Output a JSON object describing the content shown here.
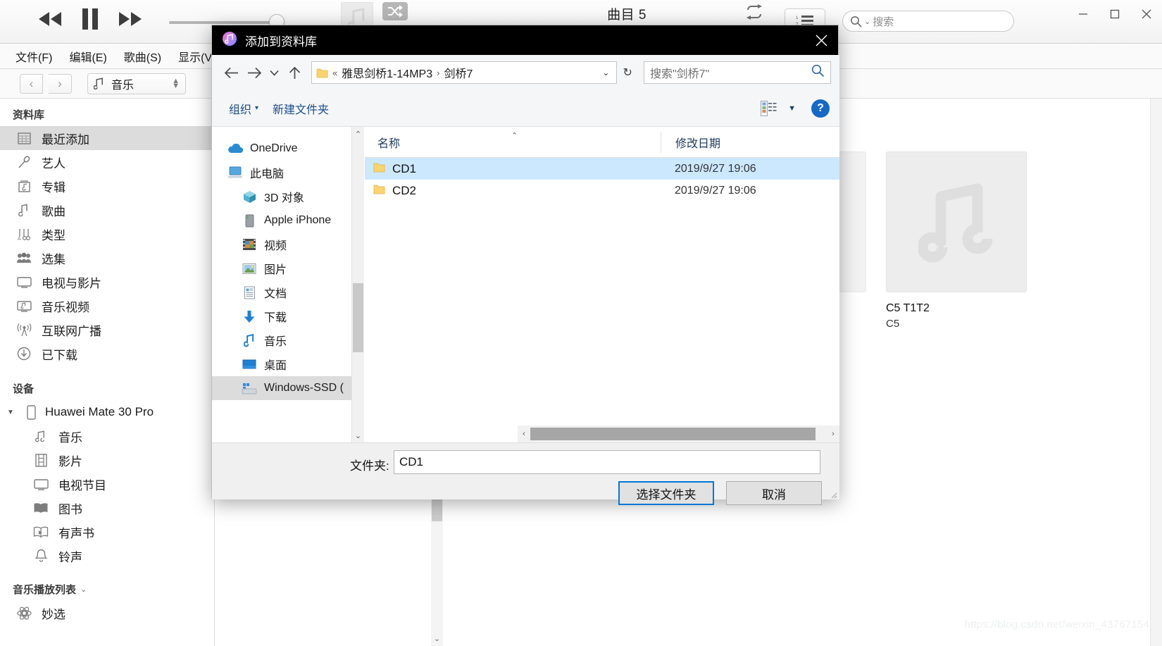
{
  "itunes": {
    "transport": {
      "previous": "rewind-icon",
      "play_pause": "pause-icon",
      "next": "fast-forward-icon"
    },
    "volume": {
      "level_percent": 89
    },
    "shuffle_label": "shuffle-icon",
    "repeat_label": "repeat-icon",
    "now_playing": "曲目 5",
    "search": {
      "placeholder": "搜索"
    },
    "window_controls": {
      "minimize": "—",
      "maximize": "▫",
      "close": "✕"
    },
    "menus": [
      "文件(F)",
      "编辑(E)",
      "歌曲(S)",
      "显示(V)"
    ],
    "library_picker": {
      "label": "音乐"
    },
    "sidebar": {
      "library_header": "资料库",
      "library_items": [
        {
          "label": "最近添加",
          "icon": "grid-icon",
          "selected": true
        },
        {
          "label": "艺人",
          "icon": "microphone-icon",
          "selected": false
        },
        {
          "label": "专辑",
          "icon": "album-icon",
          "selected": false
        },
        {
          "label": "歌曲",
          "icon": "note-icon",
          "selected": false
        },
        {
          "label": "类型",
          "icon": "genre-icon",
          "selected": false
        },
        {
          "label": "选集",
          "icon": "people-icon",
          "selected": false
        },
        {
          "label": "电视与影片",
          "icon": "tv-icon",
          "selected": false
        },
        {
          "label": "音乐视频",
          "icon": "music-video-icon",
          "selected": false
        },
        {
          "label": "互联网广播",
          "icon": "radio-icon",
          "selected": false
        },
        {
          "label": "已下载",
          "icon": "download-icon",
          "selected": false
        }
      ],
      "devices_header": "设备",
      "device_name": "Huawei Mate 30 Pro",
      "device_items": [
        {
          "label": "音乐",
          "icon": "note-icon"
        },
        {
          "label": "影片",
          "icon": "film-icon"
        },
        {
          "label": "电视节目",
          "icon": "tv-icon"
        },
        {
          "label": "图书",
          "icon": "book-icon"
        },
        {
          "label": "有声书",
          "icon": "audiobook-icon"
        },
        {
          "label": "铃声",
          "icon": "bell-icon"
        }
      ],
      "playlists_header": "音乐播放列表",
      "playlist_items": [
        {
          "label": "妙选",
          "icon": "genius-icon"
        }
      ]
    },
    "album": {
      "title": "C5 T1T2",
      "artist": "C5"
    },
    "watermark": "https://blog.csdn.net/weixin_43767154"
  },
  "dialog": {
    "title": "添加到资料库",
    "close_label": "✕",
    "address": {
      "back": "back-arrow-icon",
      "forward": "forward-arrow-icon",
      "recent": "chevron-down-icon",
      "up": "up-arrow-icon",
      "prefix": "«",
      "crumbs": [
        "雅思剑桥1-14MP3",
        "剑桥7"
      ],
      "separator": "›",
      "dropdown": "⌄",
      "refresh": "↻"
    },
    "search": {
      "placeholder": "搜索\"剑桥7\""
    },
    "toolbar": {
      "organize": "组织",
      "new_folder": "新建文件夹",
      "view_mode": "view-options-icon",
      "help": "?"
    },
    "nav": [
      {
        "label": "OneDrive",
        "icon": "onedrive-icon",
        "level": 1,
        "selected": false
      },
      {
        "label": "此电脑",
        "icon": "this-pc-icon",
        "level": 1,
        "selected": false
      },
      {
        "label": "3D 对象",
        "icon": "3d-objects-icon",
        "level": 2,
        "selected": false
      },
      {
        "label": "Apple iPhone",
        "icon": "iphone-icon",
        "level": 2,
        "selected": false
      },
      {
        "label": "视频",
        "icon": "videos-icon",
        "level": 2,
        "selected": false
      },
      {
        "label": "图片",
        "icon": "pictures-icon",
        "level": 2,
        "selected": false
      },
      {
        "label": "文档",
        "icon": "documents-icon",
        "level": 2,
        "selected": false
      },
      {
        "label": "下载",
        "icon": "downloads-icon",
        "level": 2,
        "selected": false
      },
      {
        "label": "音乐",
        "icon": "music-icon",
        "level": 2,
        "selected": false
      },
      {
        "label": "桌面",
        "icon": "desktop-icon",
        "level": 2,
        "selected": false
      },
      {
        "label": "Windows-SSD (",
        "icon": "drive-icon",
        "level": 2,
        "selected": true
      }
    ],
    "columns": {
      "name": "名称",
      "date": "修改日期"
    },
    "files": [
      {
        "name": "CD1",
        "date": "2019/9/27 19:06",
        "icon": "folder-icon",
        "selected": true
      },
      {
        "name": "CD2",
        "date": "2019/9/27 19:06",
        "icon": "folder-icon",
        "selected": false
      }
    ],
    "footer": {
      "folder_label": "文件夹:",
      "folder_value": "CD1",
      "select_button": "选择文件夹",
      "cancel_button": "取消"
    }
  }
}
